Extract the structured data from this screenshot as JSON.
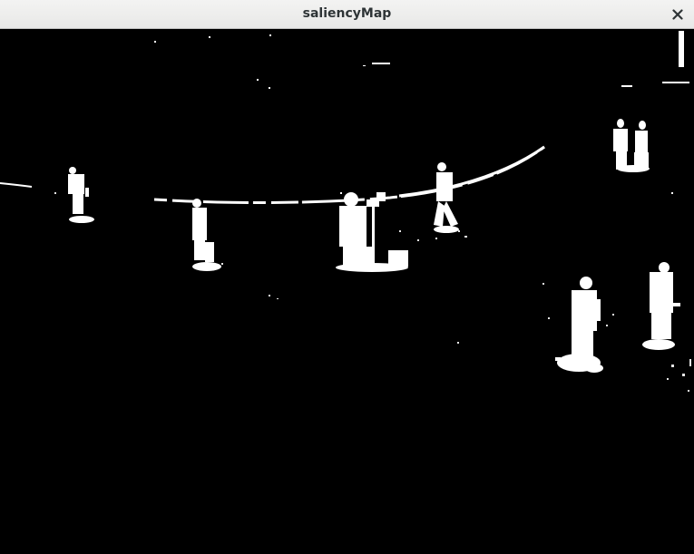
{
  "window": {
    "title": "saliencyMap"
  },
  "icons": {
    "close": "close-icon"
  },
  "colors": {
    "background": "#000000",
    "foreground": "#ffffff",
    "titlebar": "#ececeb",
    "title_text": "#2e3436"
  }
}
